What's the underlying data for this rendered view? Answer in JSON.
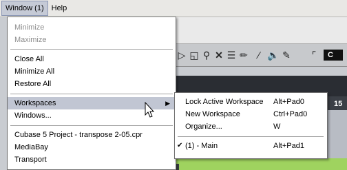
{
  "menubar": {
    "items": [
      {
        "label": "Window (1)"
      },
      {
        "label": "Help"
      }
    ]
  },
  "window_menu": {
    "items": [
      {
        "label": "Minimize",
        "enabled": false
      },
      {
        "label": "Maximize",
        "enabled": false
      },
      {
        "label": "Close All"
      },
      {
        "label": "Minimize All"
      },
      {
        "label": "Restore All"
      },
      {
        "label": "Workspaces",
        "has_submenu": true
      },
      {
        "label": "Windows..."
      },
      {
        "label": "Cubase 5 Project - transpose 2-05.cpr"
      },
      {
        "label": "MediaBay"
      },
      {
        "label": "Transport"
      }
    ]
  },
  "workspaces_submenu": {
    "items": [
      {
        "label": "Lock Active Workspace",
        "shortcut": "Alt+Pad0"
      },
      {
        "label": "New Workspace",
        "shortcut": "Ctrl+Pad0"
      },
      {
        "label": "Organize...",
        "shortcut": "W"
      },
      {
        "label": "(1) - Main",
        "shortcut": "Alt+Pad1",
        "checked": true
      }
    ]
  },
  "background": {
    "ruler_number": "15",
    "toolbar_letter": "C"
  }
}
